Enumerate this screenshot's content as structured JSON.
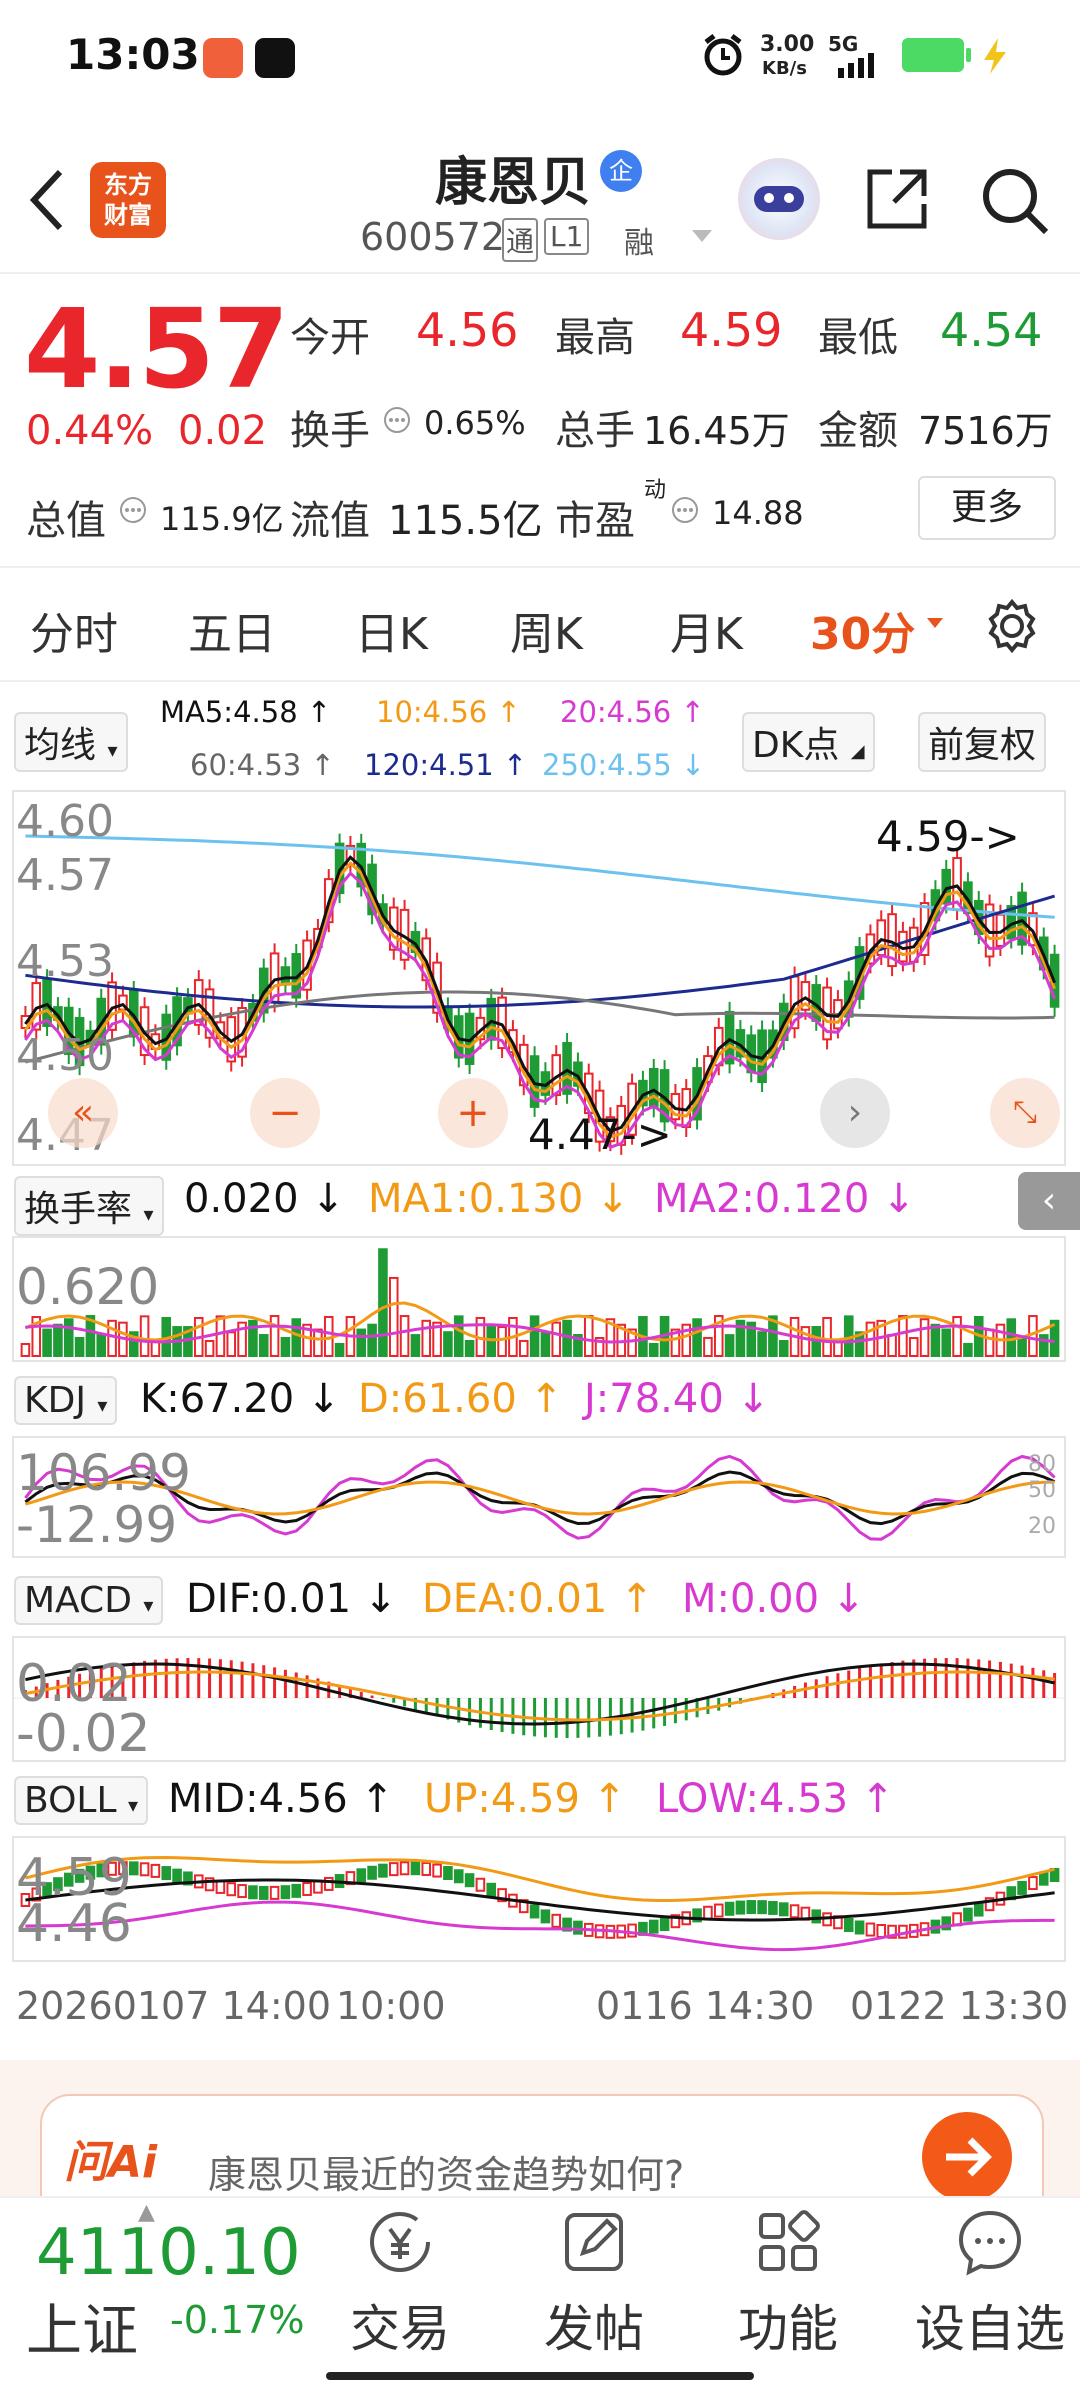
{
  "status_bar": {
    "time": "13:03",
    "net_speed_top": "3.00",
    "net_speed_bottom": "KB/s",
    "signal": "5G"
  },
  "header": {
    "title": "康恩贝",
    "title_badge": "企",
    "code": "600572",
    "tags": [
      "通",
      "L1",
      "融"
    ],
    "logo_line1": "东方",
    "logo_line2": "财富"
  },
  "quote": {
    "price": "4.57",
    "change_pct": "0.44%",
    "change_abs": "0.02",
    "open_label": "今开",
    "open": "4.56",
    "high_label": "最高",
    "high": "4.59",
    "low_label": "最低",
    "low": "4.54",
    "turnover_label": "换手",
    "turnover": "0.65%",
    "volume_label": "总手",
    "volume": "16.45万",
    "amount_label": "金额",
    "amount": "7516万",
    "mktcap_label": "总值",
    "mktcap": "115.9亿",
    "float_label": "流值",
    "float_cap": "115.5亿",
    "pe_label": "市盈",
    "pe_sup": "动",
    "pe": "14.88",
    "more": "更多"
  },
  "tabs": [
    "分时",
    "五日",
    "日K",
    "周K",
    "月K",
    "30分"
  ],
  "ma_bar": {
    "select": "均线",
    "ma5": "MA5:4.58 ↑",
    "ma10": "10:4.56 ↑",
    "ma20": "20:4.56 ↑",
    "ma60": "60:4.53 ↑",
    "ma120": "120:4.51 ↑",
    "ma250": "250:4.55 ↓",
    "dk": "DK点",
    "fuquan": "前复权"
  },
  "colors": {
    "up": "#e8262b",
    "down": "#1e9b35",
    "ma5": "#111111",
    "ma10": "#f29a16",
    "ma20": "#d63ad1",
    "ma60": "#777777",
    "ma120": "#1d2b8f",
    "ma250": "#6cc1ee"
  },
  "kline": {
    "y_labels": [
      "4.60",
      "4.57",
      "4.53",
      "4.50",
      "4.47"
    ],
    "high_marker": "4.59->",
    "low_marker": "4.47->"
  },
  "turnover_panel": {
    "select": "换手率",
    "value": "0.020 ↓",
    "ma1": "MA1:0.130 ↓",
    "ma2": "MA2:0.120 ↓",
    "y_label": "0.620"
  },
  "kdj_panel": {
    "select": "KDJ",
    "k": "K:67.20 ↓",
    "d": "D:61.60 ↑",
    "j": "J:78.40 ↓",
    "y_top": "106.99",
    "y_bottom": "-12.99",
    "right_top": "80",
    "right_mid": "50",
    "right_bot": "20"
  },
  "macd_panel": {
    "select": "MACD",
    "dif": "DIF:0.01 ↓",
    "dea": "DEA:0.01 ↑",
    "m": "M:0.00 ↓",
    "y_top": "0.02",
    "y_bottom": "-0.02"
  },
  "boll_panel": {
    "select": "BOLL",
    "mid": "MID:4.56 ↑",
    "up": "UP:4.59 ↑",
    "low": "LOW:4.53 ↑",
    "y_top": "4.59",
    "y_bottom": "4.46"
  },
  "x_axis": [
    "20260107 14:00",
    "10:00",
    "0116 14:30",
    "0122 13:30"
  ],
  "ai_bar": {
    "logo": "问Ai",
    "question": "康恩贝最近的资金趋势如何?"
  },
  "bottom_nav": {
    "index_value": "4110.10",
    "index_name": "上证",
    "index_change": "-0.17%",
    "items": [
      "交易",
      "发帖",
      "功能",
      "设自选"
    ]
  }
}
